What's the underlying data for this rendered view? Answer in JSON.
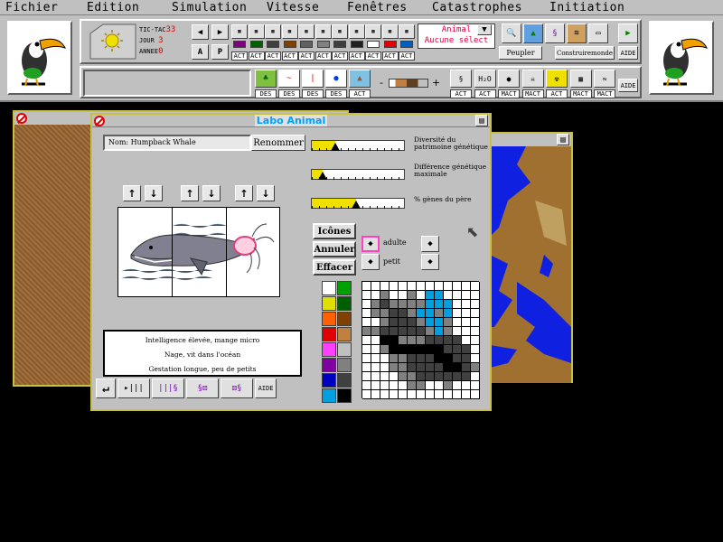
{
  "menu": [
    "Fichier",
    "Edition",
    "Simulation",
    "Vitesse",
    "Fenêtres",
    "Catastrophes",
    "Initiation"
  ],
  "clock": {
    "tic_label": "TIC-TAC",
    "tic_value": "33",
    "jour_label": "JOUR",
    "jour_value": "3",
    "annee_label": "ANNEE",
    "annee_value": "0"
  },
  "mode_buttons": {
    "a": "A",
    "p": "P"
  },
  "act_label": "ACT",
  "des_label": "DES",
  "mact_label": "MACT",
  "selection": {
    "line1": "Animal",
    "line2": "Aucune sélect"
  },
  "toolbar_buttons": {
    "peupler": "Peupler",
    "construire": "Construiremonde",
    "aide": "AIDE",
    "aide2": "AIDE"
  },
  "climate_minus": "-",
  "climate_plus": "+",
  "labo": {
    "title": "Labo Animal",
    "name_field": "Nom: Humpback Whale",
    "rename_button": "Renommer",
    "sliders": [
      {
        "label": "Diversité du patrimoine génétique",
        "value": 0.25
      },
      {
        "label": "Différence génétique maximale",
        "value": 0.12
      },
      {
        "label": "% gènes du père",
        "value": 0.48
      }
    ],
    "buttons": {
      "icones": "Icônes",
      "annuler": "Annuler",
      "effacer": "Effacer"
    },
    "icon_labels": {
      "adulte": "adulte",
      "petit": "petit"
    },
    "description": [
      "Intelligence élevée, mange micro",
      "Nage, vit dans l'océan",
      "Gestation longue, peu de petits"
    ],
    "aide": "AIDE"
  },
  "palette": [
    "#ffffff",
    "#00a000",
    "#e0e000",
    "#006000",
    "#ff6000",
    "#804000",
    "#e00000",
    "#c08040",
    "#ff40ff",
    "#c0c0c0",
    "#8000a0",
    "#808080",
    "#0000c0",
    "#404040",
    "#00a0e0",
    "#000000"
  ],
  "colors": {
    "window_border": "#c8c040",
    "title_text": "#00a0ff",
    "menu_bg": "#c0c0c0"
  }
}
